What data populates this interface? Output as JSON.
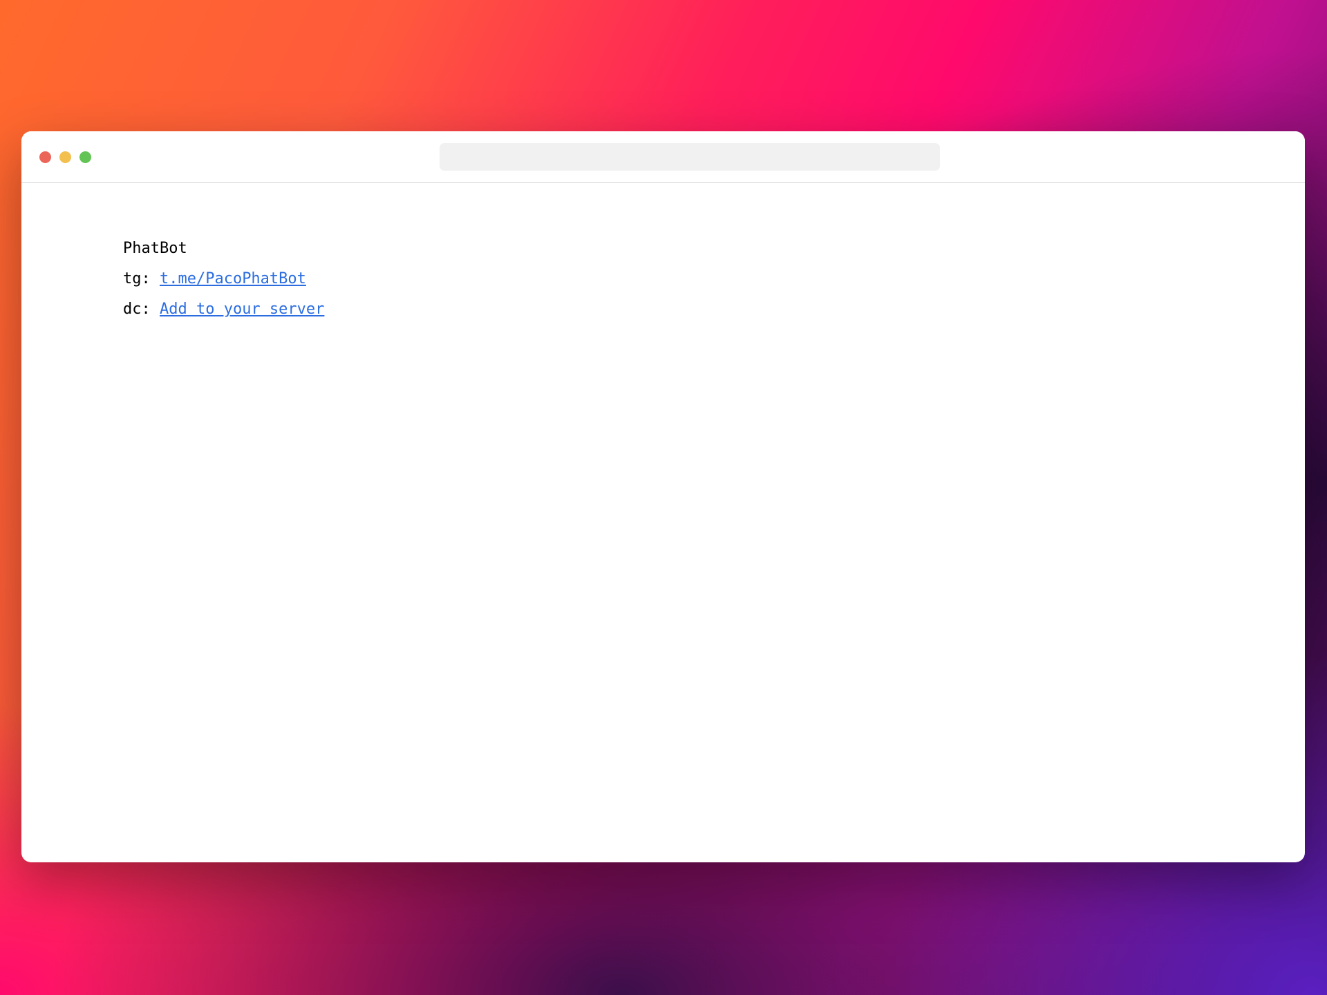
{
  "window": {
    "controls": {
      "close": "close",
      "minimize": "minimize",
      "maximize": "maximize"
    },
    "url": ""
  },
  "page": {
    "title": "PhatBot",
    "links": [
      {
        "prefix": "tg: ",
        "label": "t.me/PacoPhatBot"
      },
      {
        "prefix": "dc: ",
        "label": "Add to your server"
      }
    ]
  },
  "colors": {
    "link": "#2b6de0",
    "close": "#ec6559",
    "minimize": "#f3bf4f",
    "maximize": "#61c454",
    "url_bar": "#f1f1f1"
  }
}
